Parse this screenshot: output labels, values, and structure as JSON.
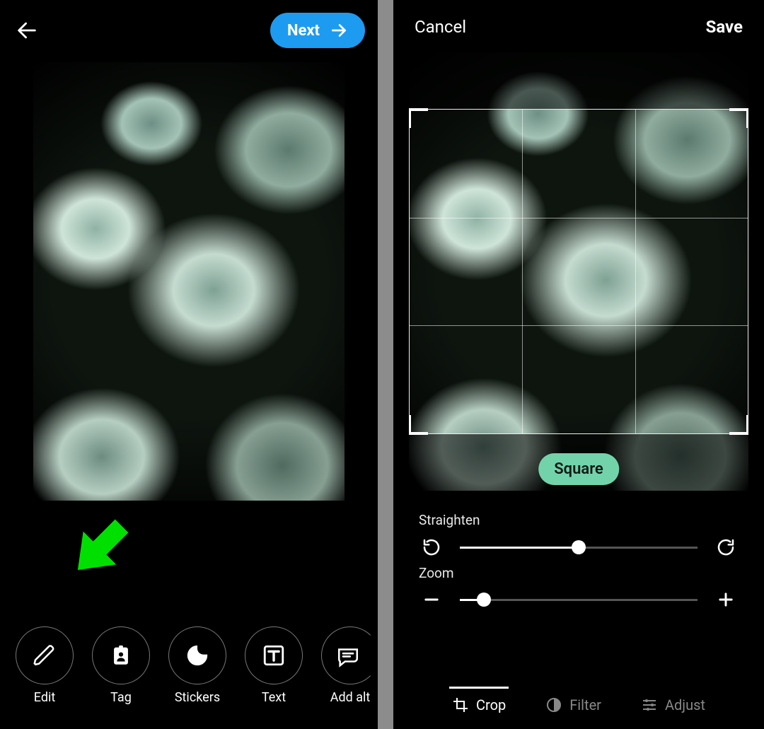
{
  "left": {
    "header": {
      "next_label": "Next"
    },
    "toolbar": {
      "items": [
        {
          "key": "edit",
          "label": "Edit",
          "icon": "pencil-icon"
        },
        {
          "key": "tag",
          "label": "Tag",
          "icon": "tag-person-icon"
        },
        {
          "key": "stickers",
          "label": "Stickers",
          "icon": "sticker-icon"
        },
        {
          "key": "text",
          "label": "Text",
          "icon": "text-icon"
        },
        {
          "key": "addalt",
          "label": "Add alt",
          "icon": "alt-text-icon"
        }
      ]
    },
    "annotation": {
      "arrow_target": "edit"
    }
  },
  "right": {
    "header": {
      "cancel_label": "Cancel",
      "save_label": "Save"
    },
    "crop": {
      "aspect_label": "Square"
    },
    "straighten": {
      "label": "Straighten",
      "value_percent": 50
    },
    "zoom": {
      "label": "Zoom",
      "value_percent": 10
    },
    "modes": {
      "items": [
        {
          "key": "crop",
          "label": "Crop",
          "active": true
        },
        {
          "key": "filter",
          "label": "Filter",
          "active": false
        },
        {
          "key": "adjust",
          "label": "Adjust",
          "active": false
        }
      ]
    }
  },
  "colors": {
    "accent_blue": "#1d9bf0",
    "accent_green": "#72d3ab",
    "annotation_green": "#00e000"
  }
}
